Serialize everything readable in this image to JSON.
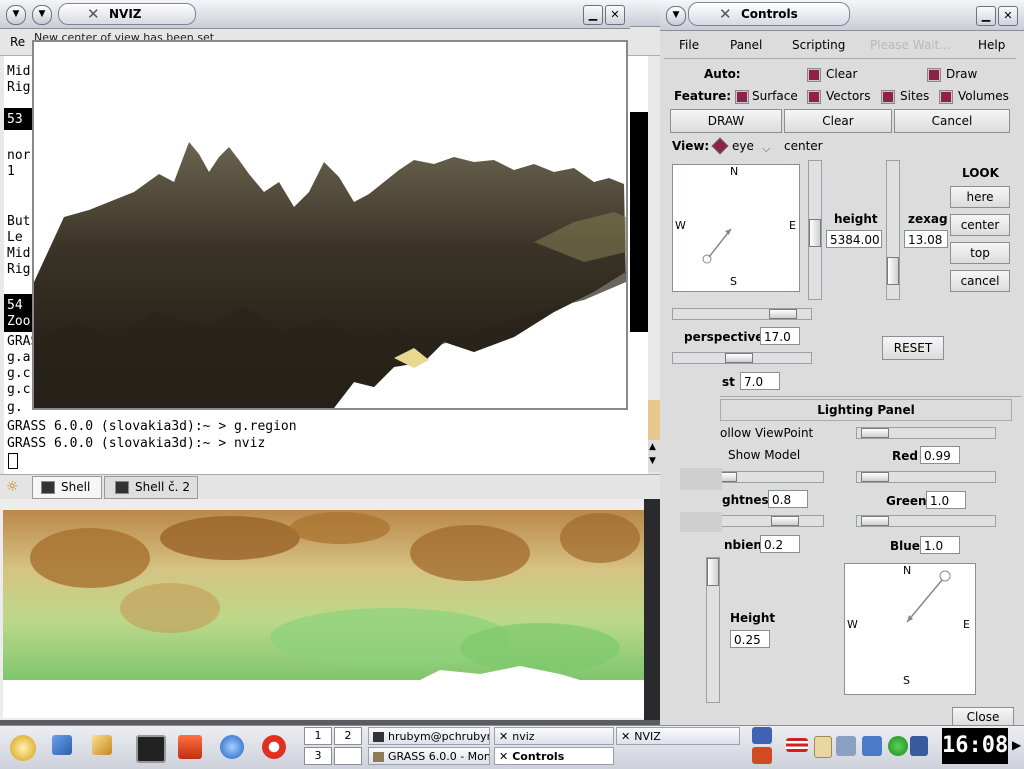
{
  "windows": {
    "nviz": {
      "title": "NVIZ"
    },
    "controls": {
      "title": "Controls"
    }
  },
  "terminal": {
    "menu_item": "Re",
    "status_message": "New center of view has been set",
    "lines_behind": [
      "Mid",
      "Rig",
      "53",
      "nor",
      "1",
      "But",
      "Le",
      "Mid",
      "Rig",
      "54",
      "Zoo"
    ],
    "lines_left": [
      "GRASS",
      "g.a",
      "g.c",
      "g.c",
      "g."
    ],
    "prompt_lines": [
      "GRASS 6.0.0 (slovakia3d):~ > g.region",
      "GRASS 6.0.0 (slovakia3d):~ > nviz"
    ],
    "tabs": [
      "Shell",
      "Shell č. 2"
    ]
  },
  "controls": {
    "menu": [
      "File",
      "Panel",
      "Scripting",
      "Please Wait...",
      "Help"
    ],
    "auto_label": "Auto:",
    "auto_clear": "Clear",
    "auto_draw": "Draw",
    "feature_label": "Feature:",
    "features": [
      "Surface",
      "Vectors",
      "Sites",
      "Volumes"
    ],
    "draw_button": "DRAW",
    "clear_button": "Clear",
    "cancel_button": "Cancel",
    "view_label": "View:",
    "view_eye": "eye",
    "view_center": "center",
    "compass": {
      "n": "N",
      "s": "S",
      "e": "E",
      "w": "W"
    },
    "height_label": "height",
    "height_value": "5384.00",
    "zexag_label": "zexag",
    "zexag_value": "13.08",
    "look_label": "LOOK",
    "look_here": "here",
    "look_center": "center",
    "look_top": "top",
    "look_cancel": "cancel",
    "perspective_label": "perspective",
    "perspective_value": "17.0",
    "twist_label": "st",
    "twist_value": "7.0",
    "reset_button": "RESET"
  },
  "lighting": {
    "title": "Lighting Panel",
    "follow_viewpoint": "ollow ViewPoint",
    "show_model": "Show Model",
    "brightness_label": "ghtness",
    "brightness_value": "0.8",
    "ambient_label": "nbient",
    "ambient_value": "0.2",
    "height_label": "Height",
    "height_value": "0.25",
    "red_label": "Red",
    "red_value": "0.99",
    "green_label": "Green",
    "green_value": "1.0",
    "blue_label": "Blue",
    "blue_value": "1.0",
    "close_button": "Close"
  },
  "taskbar": {
    "desktops": [
      "1",
      "2",
      "3"
    ],
    "tasks": [
      "hrubym@pchrubym",
      "nviz",
      "NVIZ",
      "GRASS 6.0.0 - Mon",
      "Controls"
    ],
    "clock": "16:08"
  },
  "colors": {
    "check": "#8d2147",
    "titlebar": "#c9cdd6",
    "panel": "#dcdcdc"
  }
}
